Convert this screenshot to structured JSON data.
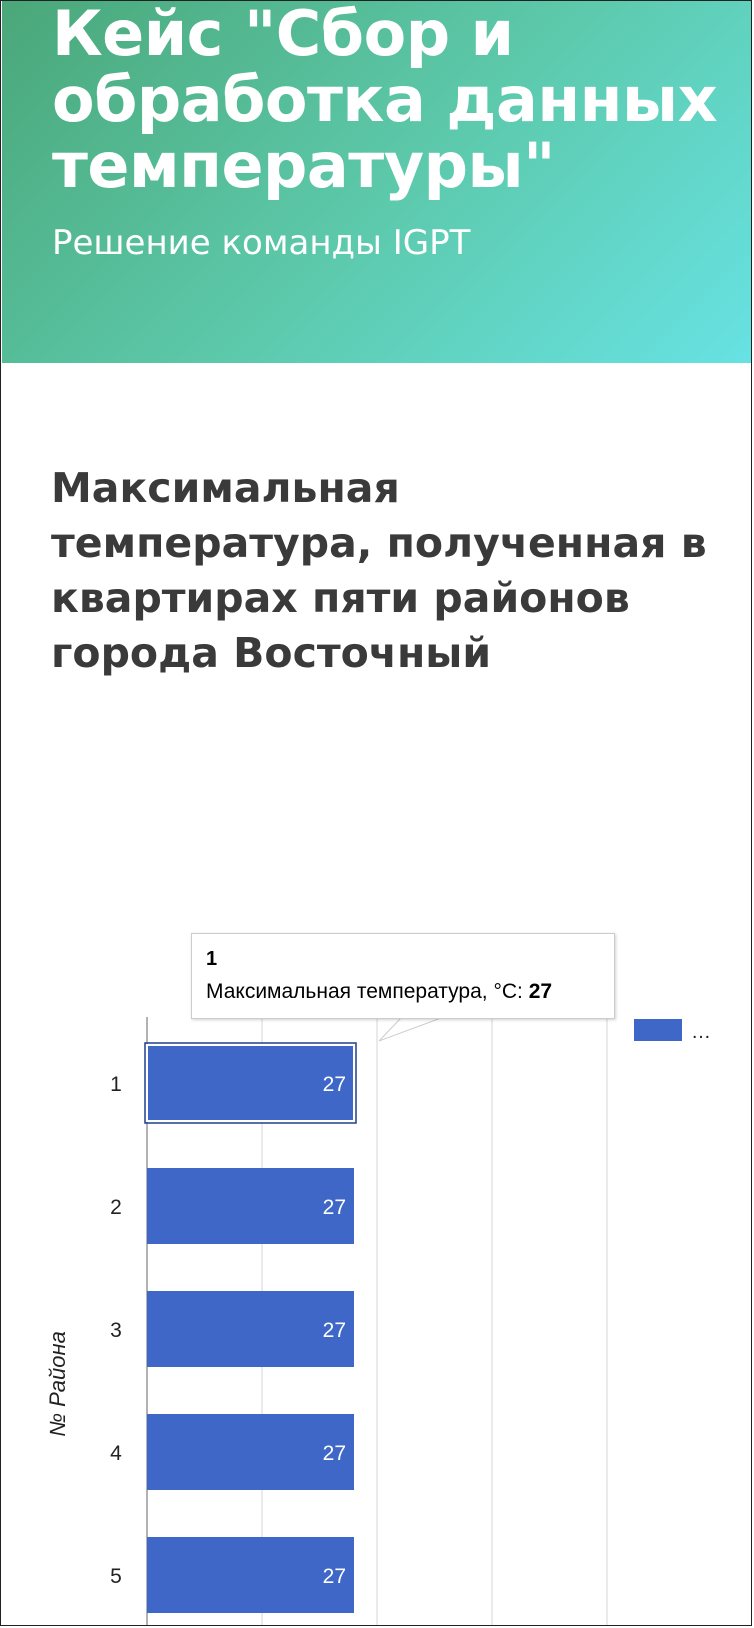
{
  "header": {
    "title": "Кейс \"Сбор и обработка данных температуры\"",
    "subtitle": "Решение команды IGPT"
  },
  "section": {
    "title": "Максимальная температура, полученная в квартирах пяти районов города Восточный"
  },
  "tooltip": {
    "category": "1",
    "series_label": "Максимальная температура, °C:",
    "value": "27"
  },
  "legend": {
    "label": "…"
  },
  "colors": {
    "bar": "#3e67c8",
    "grid": "#d6d6d6",
    "axis": "#999999"
  },
  "chart_data": {
    "type": "bar",
    "orientation": "horizontal",
    "categories": [
      "1",
      "2",
      "3",
      "4",
      "5"
    ],
    "series": [
      {
        "name": "Максимальная температура, °C",
        "values": [
          27,
          27,
          27,
          27,
          27
        ]
      }
    ],
    "data_labels": [
      "27",
      "27",
      "27",
      "27",
      "27"
    ],
    "ylabel": "№ Района",
    "xlim": [
      0,
      60
    ],
    "grid": true,
    "legend_position": "top-right",
    "highlighted_category": "1"
  }
}
